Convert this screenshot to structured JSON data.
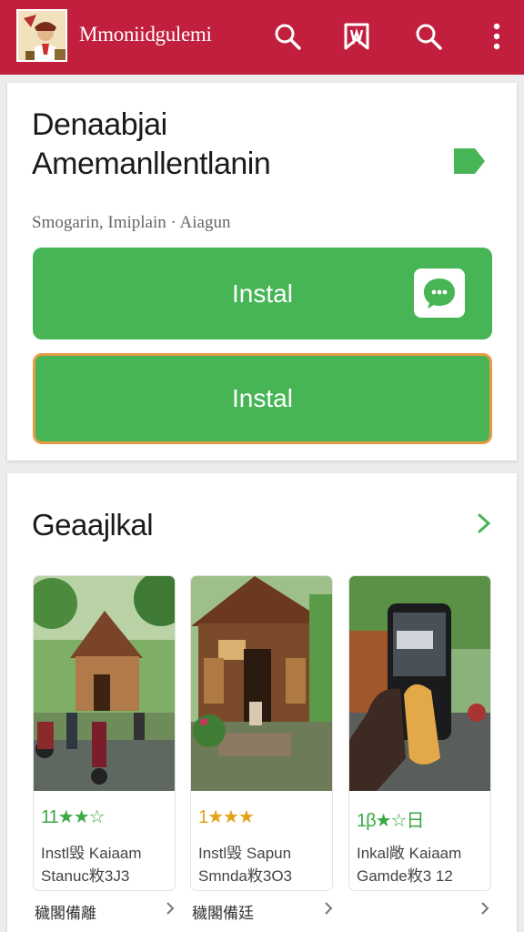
{
  "header": {
    "app_name": "Mmoniidgulemi",
    "icons": [
      "search-icon",
      "bookmark-icon",
      "search-icon",
      "more-vert-icon"
    ]
  },
  "hero": {
    "title_line1": "Denaabjai",
    "title_line2": "Amemanllentlanin",
    "subtitle": "Smogarin, Imiplain · Aiagun",
    "install_label": "Instal",
    "install2_label": "Instal"
  },
  "section": {
    "title": "Geaajlkal",
    "apps": [
      {
        "rating": "11★★☆",
        "line1": "Instl毁 Kaiaam",
        "line2": "Stanuc敉3J3",
        "footer": "穢閣備離"
      },
      {
        "rating": "1★★★",
        "line1": "Instl毁 Sapun",
        "line2": "Smnda敉3O3",
        "footer": "穢閣備廷"
      },
      {
        "rating": "1β★☆日",
        "line1": "Inkal敞 Kaiaam",
        "line2": "Gamde敉3 12",
        "footer": ""
      }
    ]
  },
  "colors": {
    "brand_red": "#c21e3d",
    "install_green": "#47b556",
    "rating_green": "#3aa845",
    "outline_orange": "#e89a45"
  }
}
